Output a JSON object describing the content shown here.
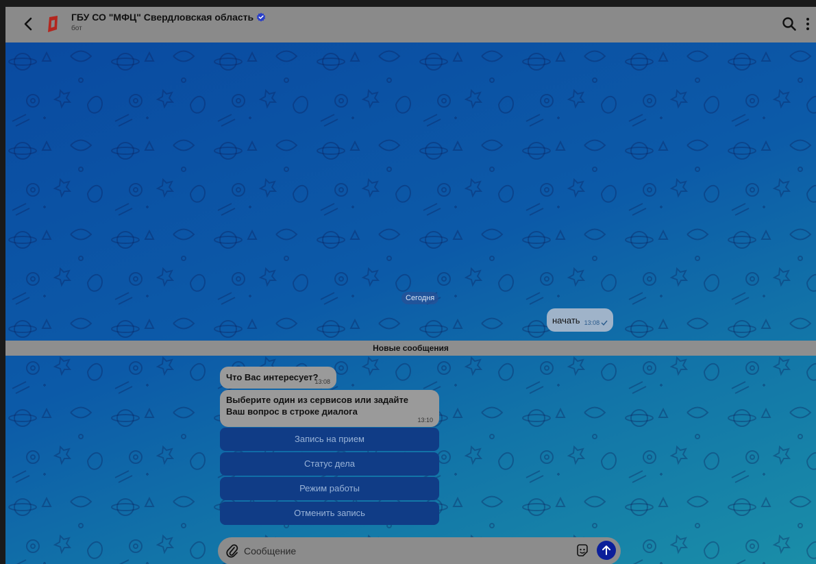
{
  "header": {
    "title": "ГБУ СО \"МФЦ\" Свердловская область",
    "subtitle": "бот",
    "icons": {
      "back": "chevron-left-icon",
      "verified": "verified-badge-icon",
      "search": "search-icon",
      "menu": "more-vertical-icon"
    }
  },
  "chat": {
    "date_label": "Сегодня",
    "outgoing": {
      "text": "начать",
      "time": "13:08"
    },
    "new_messages_label": "Новые сообщения",
    "incoming": [
      {
        "text": "Что Вас интересует?",
        "time": "13:08"
      },
      {
        "text": "Выберите один из сервисов или задайте Ваш вопрос в строке диалога",
        "time": "13:10"
      }
    ],
    "keyboard": [
      {
        "label": "Запись на прием"
      },
      {
        "label": "Статус дела"
      },
      {
        "label": "Режим работы"
      },
      {
        "label": "Отменить запись"
      }
    ]
  },
  "composer": {
    "placeholder": "Сообщение",
    "icons": {
      "attach": "paperclip-icon",
      "emoji": "sticker-icon",
      "send": "send-arrow-icon"
    }
  },
  "colors": {
    "header_bg": "#8a8a8a",
    "chat_bg_top": "#0a4aa0",
    "chat_bg_bottom": "#1a8ea8",
    "keyboard_button": "#103c86",
    "send_button": "#0b1f9a",
    "verified": "#2a3fc8"
  }
}
